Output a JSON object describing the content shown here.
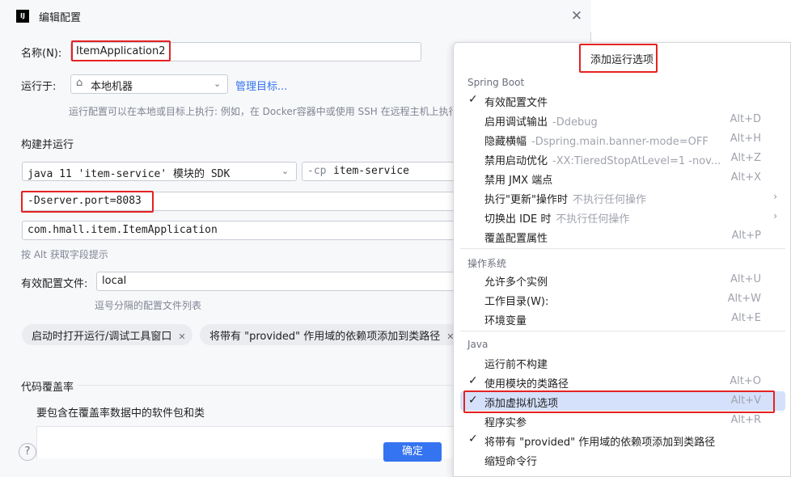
{
  "dialog": {
    "app_icon_text": "IJ",
    "title": "编辑配置",
    "name_label": "名称(N):",
    "name_value": "ItemApplication2",
    "run_on_label": "运行于:",
    "run_on_value": "本地机器",
    "manage_targets": "管理目标...",
    "run_on_hint": "运行配置可以在本地或目标上执行: 例如，在 Docker容器中或使用 SSH 在远程主机上执行",
    "build_run_heading": "构建并运行",
    "jdk_value": "java 11 'item-service' 模块的 SDK",
    "cp_prefix": "-cp",
    "cp_value": "item-service",
    "vm_options": "-Dserver.port=8083",
    "main_class": "com.hmall.item.ItemApplication",
    "alt_hint": "按 Alt 获取字段提示",
    "profiles_label": "有效配置文件:",
    "profiles_value": "local",
    "profiles_hint": "逗号分隔的配置文件列表",
    "chips": [
      "启动时打开运行/调试工具窗口",
      "将带有 \"provided\" 作用域的依赖项添加到类路径"
    ],
    "coverage_heading": "代码覆盖率",
    "coverage_sub": "要包含在覆盖率数据中的软件包和类",
    "help": "?",
    "ok": "确定"
  },
  "popup": {
    "title": "添加运行选项",
    "sections": [
      {
        "name": "Spring Boot"
      },
      {
        "name": "操作系统"
      },
      {
        "name": "Java"
      }
    ],
    "spring": [
      {
        "checked": true,
        "label": "有效配置文件",
        "desc": "",
        "shortcut": ""
      },
      {
        "checked": false,
        "label": "启用调试输出",
        "desc": "-Ddebug",
        "shortcut": "Alt+D"
      },
      {
        "checked": false,
        "label": "隐藏横幅",
        "desc": "-Dspring.main.banner-mode=OFF",
        "shortcut": "Alt+H"
      },
      {
        "checked": false,
        "label": "禁用启动优化",
        "desc": "-XX:TieredStopAtLevel=1 -nov...",
        "shortcut": "Alt+Z"
      },
      {
        "checked": false,
        "label": "禁用 JMX 端点",
        "desc": "",
        "shortcut": "Alt+X"
      },
      {
        "checked": false,
        "label": "执行\"更新\"操作时",
        "desc": "不执行任何操作",
        "shortcut": "",
        "arrow": true
      },
      {
        "checked": false,
        "label": "切换出 IDE 时",
        "desc": "不执行任何操作",
        "shortcut": "",
        "arrow": true
      },
      {
        "checked": false,
        "label": "覆盖配置属性",
        "desc": "",
        "shortcut": "Alt+P"
      }
    ],
    "os": [
      {
        "checked": false,
        "label": "允许多个实例",
        "desc": "",
        "shortcut": "Alt+U"
      },
      {
        "checked": false,
        "label": "工作目录(W):",
        "desc": "",
        "shortcut": "Alt+W"
      },
      {
        "checked": false,
        "label": "环境变量",
        "desc": "",
        "shortcut": "Alt+E"
      }
    ],
    "java": [
      {
        "checked": false,
        "label": "运行前不构建",
        "desc": "",
        "shortcut": ""
      },
      {
        "checked": true,
        "label": "使用模块的类路径",
        "desc": "",
        "shortcut": "Alt+O"
      },
      {
        "checked": true,
        "label": "添加虚拟机选项",
        "desc": "",
        "shortcut": "Alt+V",
        "selected": true
      },
      {
        "checked": false,
        "label": "程序实参",
        "desc": "",
        "shortcut": "Alt+R"
      },
      {
        "checked": true,
        "label": "将带有 \"provided\" 作用域的依赖项添加到类路径",
        "desc": "",
        "shortcut": ""
      },
      {
        "checked": false,
        "label": "缩短命令行",
        "desc": "",
        "shortcut": ""
      }
    ]
  }
}
